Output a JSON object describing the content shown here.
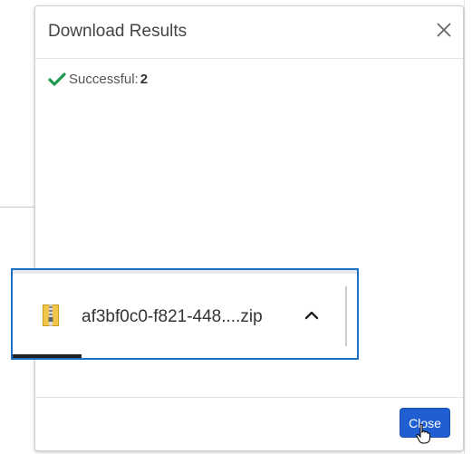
{
  "dialog": {
    "title": "Download Results",
    "status": {
      "label": "Successful:",
      "count": "2",
      "icon": "check-icon",
      "color": "#1e9a50"
    },
    "close_button_label": "Close",
    "accent": "#1f5fd1"
  },
  "download_shelf": {
    "file_name": "af3bf0c0-f821-448....zip",
    "file_icon": "zip-file-icon",
    "menu_icon": "chevron-up-icon",
    "progress_fraction": 0.2,
    "border_color": "#1e6fc7"
  }
}
